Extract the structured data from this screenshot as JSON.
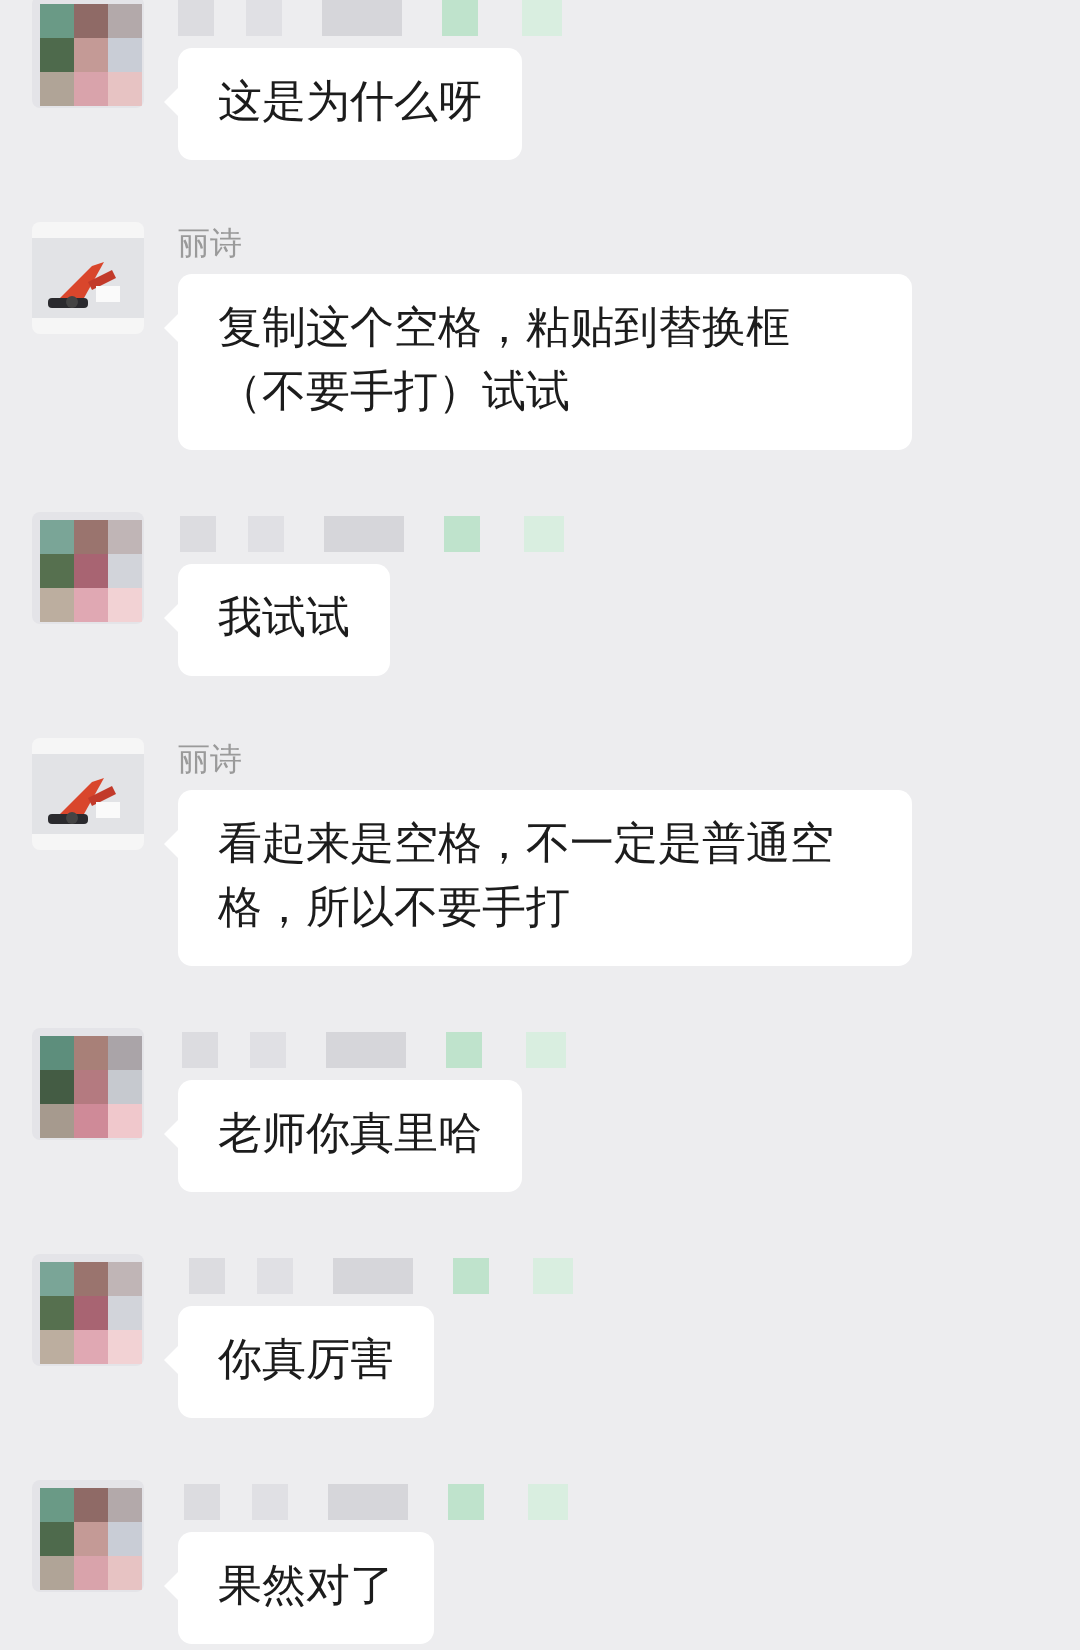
{
  "messages": [
    {
      "kind": "masked",
      "text": "这是为什么呀"
    },
    {
      "kind": "named",
      "sender": "丽诗",
      "text": "复制这个空格，粘贴到替换框（不要手打）试试"
    },
    {
      "kind": "masked",
      "text": "我试试"
    },
    {
      "kind": "named",
      "sender": "丽诗",
      "text": "看起来是空格，不一定是普通空格，所以不要手打"
    },
    {
      "kind": "masked",
      "text": "老师你真里哈"
    },
    {
      "kind": "masked",
      "text": "你真厉害"
    },
    {
      "kind": "masked",
      "text": "果然对了"
    }
  ]
}
